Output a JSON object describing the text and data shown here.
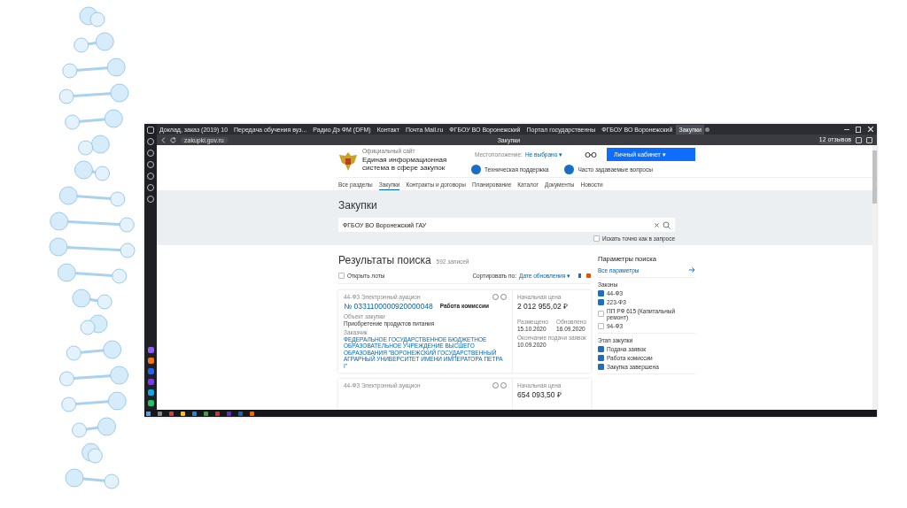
{
  "browser": {
    "tabs": [
      {
        "title": "Доклад, заказ (2019) 10",
        "selected": false
      },
      {
        "title": "Передача обучения вуз...",
        "selected": false
      },
      {
        "title": "Радио Дэ ФМ (DFM)",
        "selected": false
      },
      {
        "title": "Контакт",
        "selected": false
      },
      {
        "title": "Почта Mail.ru",
        "selected": false
      },
      {
        "title": "ФГБОУ ВО Воронежский",
        "selected": false
      },
      {
        "title": "Портал государственны",
        "selected": false
      },
      {
        "title": "ФГБОУ ВО Воронежский",
        "selected": false
      },
      {
        "title": "Закупки",
        "selected": true
      }
    ],
    "address": "zakupki.gov.ru",
    "page_title": "Закупки",
    "badge": "12 отзывов"
  },
  "site": {
    "official": "Официальный сайт",
    "name": "Единая информационная система в сфере закупок",
    "location_label": "Местоположение:",
    "location_value": "Не выбрано ▾",
    "account_button": "Личный кабинет ▾",
    "support": "Техническая поддержка",
    "faq": "Часто задаваемые вопросы",
    "nav": [
      {
        "label": "Все разделы",
        "selected": false
      },
      {
        "label": "Закупки",
        "selected": true
      },
      {
        "label": "Контракты и договоры",
        "selected": false
      },
      {
        "label": "Планирование",
        "selected": false
      },
      {
        "label": "Каталог",
        "selected": false
      },
      {
        "label": "Документы",
        "selected": false
      },
      {
        "label": "Новости",
        "selected": false
      }
    ]
  },
  "search": {
    "heading": "Закупки",
    "value": "ФГБОУ ВО Воронежский ГАУ",
    "exact_label": "Искать точно как в запросе",
    "exact_checked": false
  },
  "results": {
    "heading": "Результаты поиска",
    "count": "592 записей",
    "open_lots": "Открыть лоты",
    "open_lots_checked": false,
    "sort_label": "Сортировать по:",
    "sort_value": "Дате обновления ▾",
    "cards": [
      {
        "type": "44-ФЗ Электронный аукцион",
        "number": "№ 0331100000920000048",
        "stage": "Работа комиссии",
        "object_label": "Объект закупки",
        "object": "Приобретение продуктов питания",
        "customer_label": "Заказчик",
        "customer": "ФЕДЕРАЛЬНОЕ ГОСУДАРСТВЕННОЕ БЮДЖЕТНОЕ ОБРАЗОВАТЕЛЬНОЕ УЧРЕЖДЕНИЕ ВЫСШЕГО ОБРАЗОВАНИЯ \"ВОРОНЕЖСКИЙ ГОСУДАРСТВЕННЫЙ АГРАРНЫЙ УНИВЕРСИТЕТ ИМЕНИ ИМПЕРАТОРА ПЕТРА I\"",
        "price_label": "Начальная цена",
        "price": "2 012 955,02 ₽",
        "posted_label": "Размещено",
        "posted": "15.10.2020",
        "updated_label": "Обновлено",
        "updated": "16.09.2020",
        "deadline_label": "Окончание подачи заявок",
        "deadline": "10.09.2020"
      },
      {
        "type": "44-ФЗ Электронный аукцион",
        "price_label": "Начальная цена",
        "price": "654 093,50 ₽"
      }
    ]
  },
  "filters": {
    "heading": "Параметры поиска",
    "all_link": "Все параметры",
    "groups": [
      {
        "title": "Законы",
        "options": [
          {
            "label": "44-ФЗ",
            "checked": true
          },
          {
            "label": "223-ФЗ",
            "checked": true
          },
          {
            "label": "ПП РФ 615 (Капитальный ремонт)",
            "checked": false
          },
          {
            "label": "94-ФЗ",
            "checked": false
          }
        ]
      },
      {
        "title": "Этап закупки",
        "options": [
          {
            "label": "Подача заявок",
            "checked": true
          },
          {
            "label": "Работа комиссии",
            "checked": true
          },
          {
            "label": "Закупка завершена",
            "checked": true
          }
        ]
      }
    ]
  }
}
